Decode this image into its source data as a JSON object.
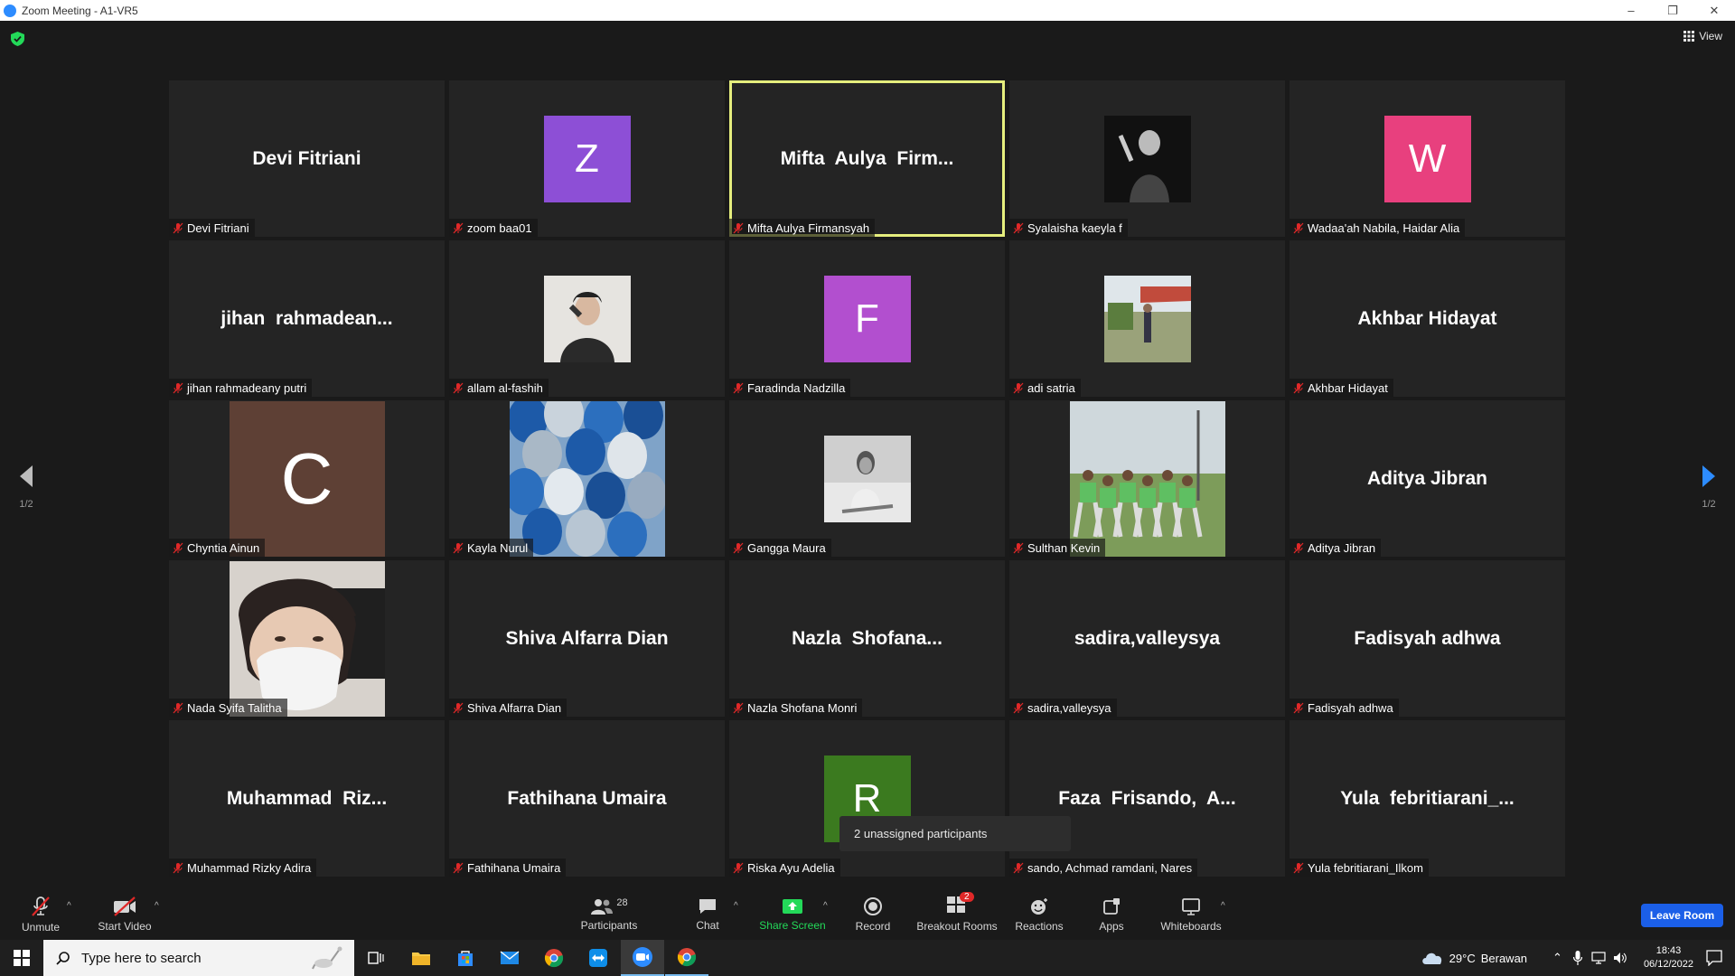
{
  "window": {
    "title": "Zoom Meeting - A1-VR5"
  },
  "meeting": {
    "view_label": "View",
    "page_left": "1/2",
    "page_right": "1/2"
  },
  "tiles": [
    {
      "name": "Devi Fitriani",
      "big": "Devi Fitriani",
      "type": "name"
    },
    {
      "name": "zoom baa01",
      "letter": "Z",
      "color": "#8d4fd6",
      "type": "letter"
    },
    {
      "name": "Mifta Aulya Firmansyah",
      "big": "Mifta  Aulya  Firm...",
      "type": "name",
      "active": true
    },
    {
      "name": "Syalaisha kaeyla f",
      "type": "photo",
      "photo": "singer"
    },
    {
      "name": "Wadaa'ah Nabila, Haidar Alia",
      "letter": "W",
      "color": "#e8407e",
      "type": "letter"
    },
    {
      "name": "jihan rahmadeany putri",
      "big": "jihan  rahmadean...",
      "type": "name"
    },
    {
      "name": "allam al-fashih",
      "type": "photo",
      "photo": "hoodie"
    },
    {
      "name": "Faradinda Nadzilla",
      "letter": "F",
      "color": "#b24fcf",
      "type": "letter"
    },
    {
      "name": "adi satria",
      "type": "photo",
      "photo": "outdoor"
    },
    {
      "name": "Akhbar Hidayat",
      "big": "Akhbar Hidayat",
      "type": "name"
    },
    {
      "name": "Chyntia Ainun",
      "letter": "C",
      "color": "#5e4035",
      "type": "bigletter"
    },
    {
      "name": "Kayla Nurul",
      "type": "photo",
      "photo": "balloons"
    },
    {
      "name": "Gangga Maura",
      "type": "photo",
      "photo": "bw"
    },
    {
      "name": "Sulthan Kevin",
      "type": "photo",
      "photo": "group"
    },
    {
      "name": "Aditya Jibran",
      "big": "Aditya Jibran",
      "type": "name"
    },
    {
      "name": "Nada Syifa Talitha",
      "type": "photo",
      "photo": "mask"
    },
    {
      "name": "Shiva Alfarra Dian",
      "big": "Shiva Alfarra Dian",
      "type": "name"
    },
    {
      "name": "Nazla Shofana Monri",
      "big": "Nazla  Shofana...",
      "type": "name"
    },
    {
      "name": "sadira,valleysya",
      "big": "sadira,valleysya",
      "type": "name"
    },
    {
      "name": "Fadisyah adhwa",
      "big": "Fadisyah adhwa",
      "type": "name"
    },
    {
      "name": "Muhammad Rizky Adira",
      "big": "Muhammad  Riz...",
      "type": "name"
    },
    {
      "name": "Fathihana Umaira",
      "big": "Fathihana Umaira",
      "type": "name"
    },
    {
      "name": "Riska Ayu Adelia",
      "letter": "R",
      "color": "#3b7a1f",
      "type": "letter"
    },
    {
      "name": "sando, Achmad ramdani, Nares",
      "big": "Faza  Frisando,  A...",
      "type": "name"
    },
    {
      "name": "Yula febritiarani_Ilkom",
      "big": "Yula  febritiarani_...",
      "type": "name"
    }
  ],
  "tooltip": "2 unassigned participants",
  "toolbar": {
    "unmute": "Unmute",
    "start_video": "Start Video",
    "participants": "Participants",
    "participants_count": "28",
    "chat": "Chat",
    "share_screen": "Share Screen",
    "record": "Record",
    "breakout_rooms": "Breakout Rooms",
    "breakout_badge": "2",
    "reactions": "Reactions",
    "apps": "Apps",
    "whiteboards": "Whiteboards",
    "leave": "Leave Room"
  },
  "taskbar": {
    "search_placeholder": "Type here to search",
    "weather_temp": "29°C",
    "weather_desc": "Berawan",
    "time": "18:43",
    "date": "06/12/2022"
  },
  "colors": {
    "active_speaker": "#e5ee7d",
    "share_green": "#23d959",
    "leave_blue": "#1b5fe8"
  }
}
